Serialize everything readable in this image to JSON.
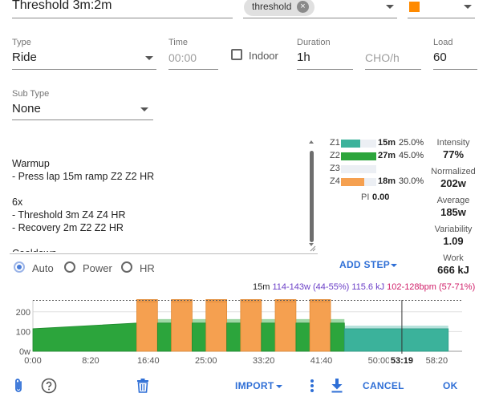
{
  "header": {
    "name_value": "Threshold 3m:2m",
    "tag_label": "threshold",
    "tag_remove_icon": "×",
    "color_hex": "#ff8a00"
  },
  "form": {
    "type_label": "Type",
    "type_value": "Ride",
    "time_label": "Time",
    "time_placeholder": "00:00",
    "indoor_label": "Indoor",
    "duration_label": "Duration",
    "duration_value": "1h",
    "cho_placeholder": "CHO/h",
    "load_label": "Load",
    "load_value": "60",
    "subtype_label": "Sub Type",
    "subtype_value": "None"
  },
  "description": {
    "lines": "Warmup\n- Press lap 15m ramp Z2 Z2 HR\n\n6x\n- Threshold 3m Z4 Z4 HR\n- Recovery 2m Z2 Z2 HR\n\nCooldown"
  },
  "zones": [
    {
      "label": "Z1",
      "time": "15m",
      "pct": "25.0%",
      "fraction": 0.25,
      "color": "#3bb29b"
    },
    {
      "label": "Z2",
      "time": "27m",
      "pct": "45.0%",
      "fraction": 0.45,
      "color": "#2ca53c"
    },
    {
      "label": "Z3",
      "time": "",
      "pct": "",
      "fraction": 0,
      "color": "#f2c200"
    },
    {
      "label": "Z4",
      "time": "18m",
      "pct": "30.0%",
      "fraction": 0.3,
      "color": "#f5a050"
    }
  ],
  "pi": {
    "label": "PI",
    "value": "0.00"
  },
  "metrics": {
    "intensity_label": "Intensity",
    "intensity_value": "77%",
    "normalized_label": "Normalized",
    "normalized_value": "202w",
    "average_label": "Average",
    "average_value": "185w",
    "variability_label": "Variability",
    "variability_value": "1.09",
    "work_label": "Work",
    "work_value": "666 kJ"
  },
  "target": {
    "options": [
      "Auto",
      "Power",
      "HR"
    ],
    "selected": "Auto"
  },
  "add_step_label": "ADD STEP",
  "summary": {
    "duration": "15m",
    "power": "114-143w (44-55%)",
    "energy": "115.6 kJ",
    "hr": "102-128bpm (57-71%)"
  },
  "chart_data": {
    "type": "area",
    "y_ticks": [
      "0w",
      "100",
      "200"
    ],
    "x_ticks": [
      "0:00",
      "8:20",
      "16:40",
      "25:00",
      "33:20",
      "41:40",
      "50:00",
      "58:20"
    ],
    "cursor_label": "53:19",
    "ylim": [
      0,
      260
    ],
    "x_range_minutes": [
      0,
      62
    ],
    "ftp_line_watts": 258,
    "segments": [
      {
        "kind": "ramp",
        "start": 0,
        "end": 15,
        "from": 114,
        "to": 143,
        "color": "#2ca53c"
      },
      {
        "kind": "interval",
        "start": 15,
        "end": 18,
        "watts": 250,
        "color": "#f5a050"
      },
      {
        "kind": "interval",
        "start": 18,
        "end": 20,
        "watts": 143,
        "color": "#2ca53c"
      },
      {
        "kind": "interval",
        "start": 20,
        "end": 23,
        "watts": 250,
        "color": "#f5a050"
      },
      {
        "kind": "interval",
        "start": 23,
        "end": 25,
        "watts": 143,
        "color": "#2ca53c"
      },
      {
        "kind": "interval",
        "start": 25,
        "end": 28,
        "watts": 250,
        "color": "#f5a050"
      },
      {
        "kind": "interval",
        "start": 28,
        "end": 30,
        "watts": 143,
        "color": "#2ca53c"
      },
      {
        "kind": "interval",
        "start": 30,
        "end": 33,
        "watts": 250,
        "color": "#f5a050"
      },
      {
        "kind": "interval",
        "start": 33,
        "end": 35,
        "watts": 143,
        "color": "#2ca53c"
      },
      {
        "kind": "interval",
        "start": 35,
        "end": 38,
        "watts": 250,
        "color": "#f5a050"
      },
      {
        "kind": "interval",
        "start": 38,
        "end": 40,
        "watts": 143,
        "color": "#2ca53c"
      },
      {
        "kind": "interval",
        "start": 40,
        "end": 43,
        "watts": 250,
        "color": "#f5a050"
      },
      {
        "kind": "interval",
        "start": 43,
        "end": 45,
        "watts": 143,
        "color": "#2ca53c"
      },
      {
        "kind": "interval",
        "start": 45,
        "end": 60,
        "watts": 114,
        "color": "#3bb29b"
      }
    ],
    "cursor_minute": 53.3
  },
  "footer": {
    "import_label": "IMPORT",
    "cancel_label": "CANCEL",
    "ok_label": "OK"
  }
}
